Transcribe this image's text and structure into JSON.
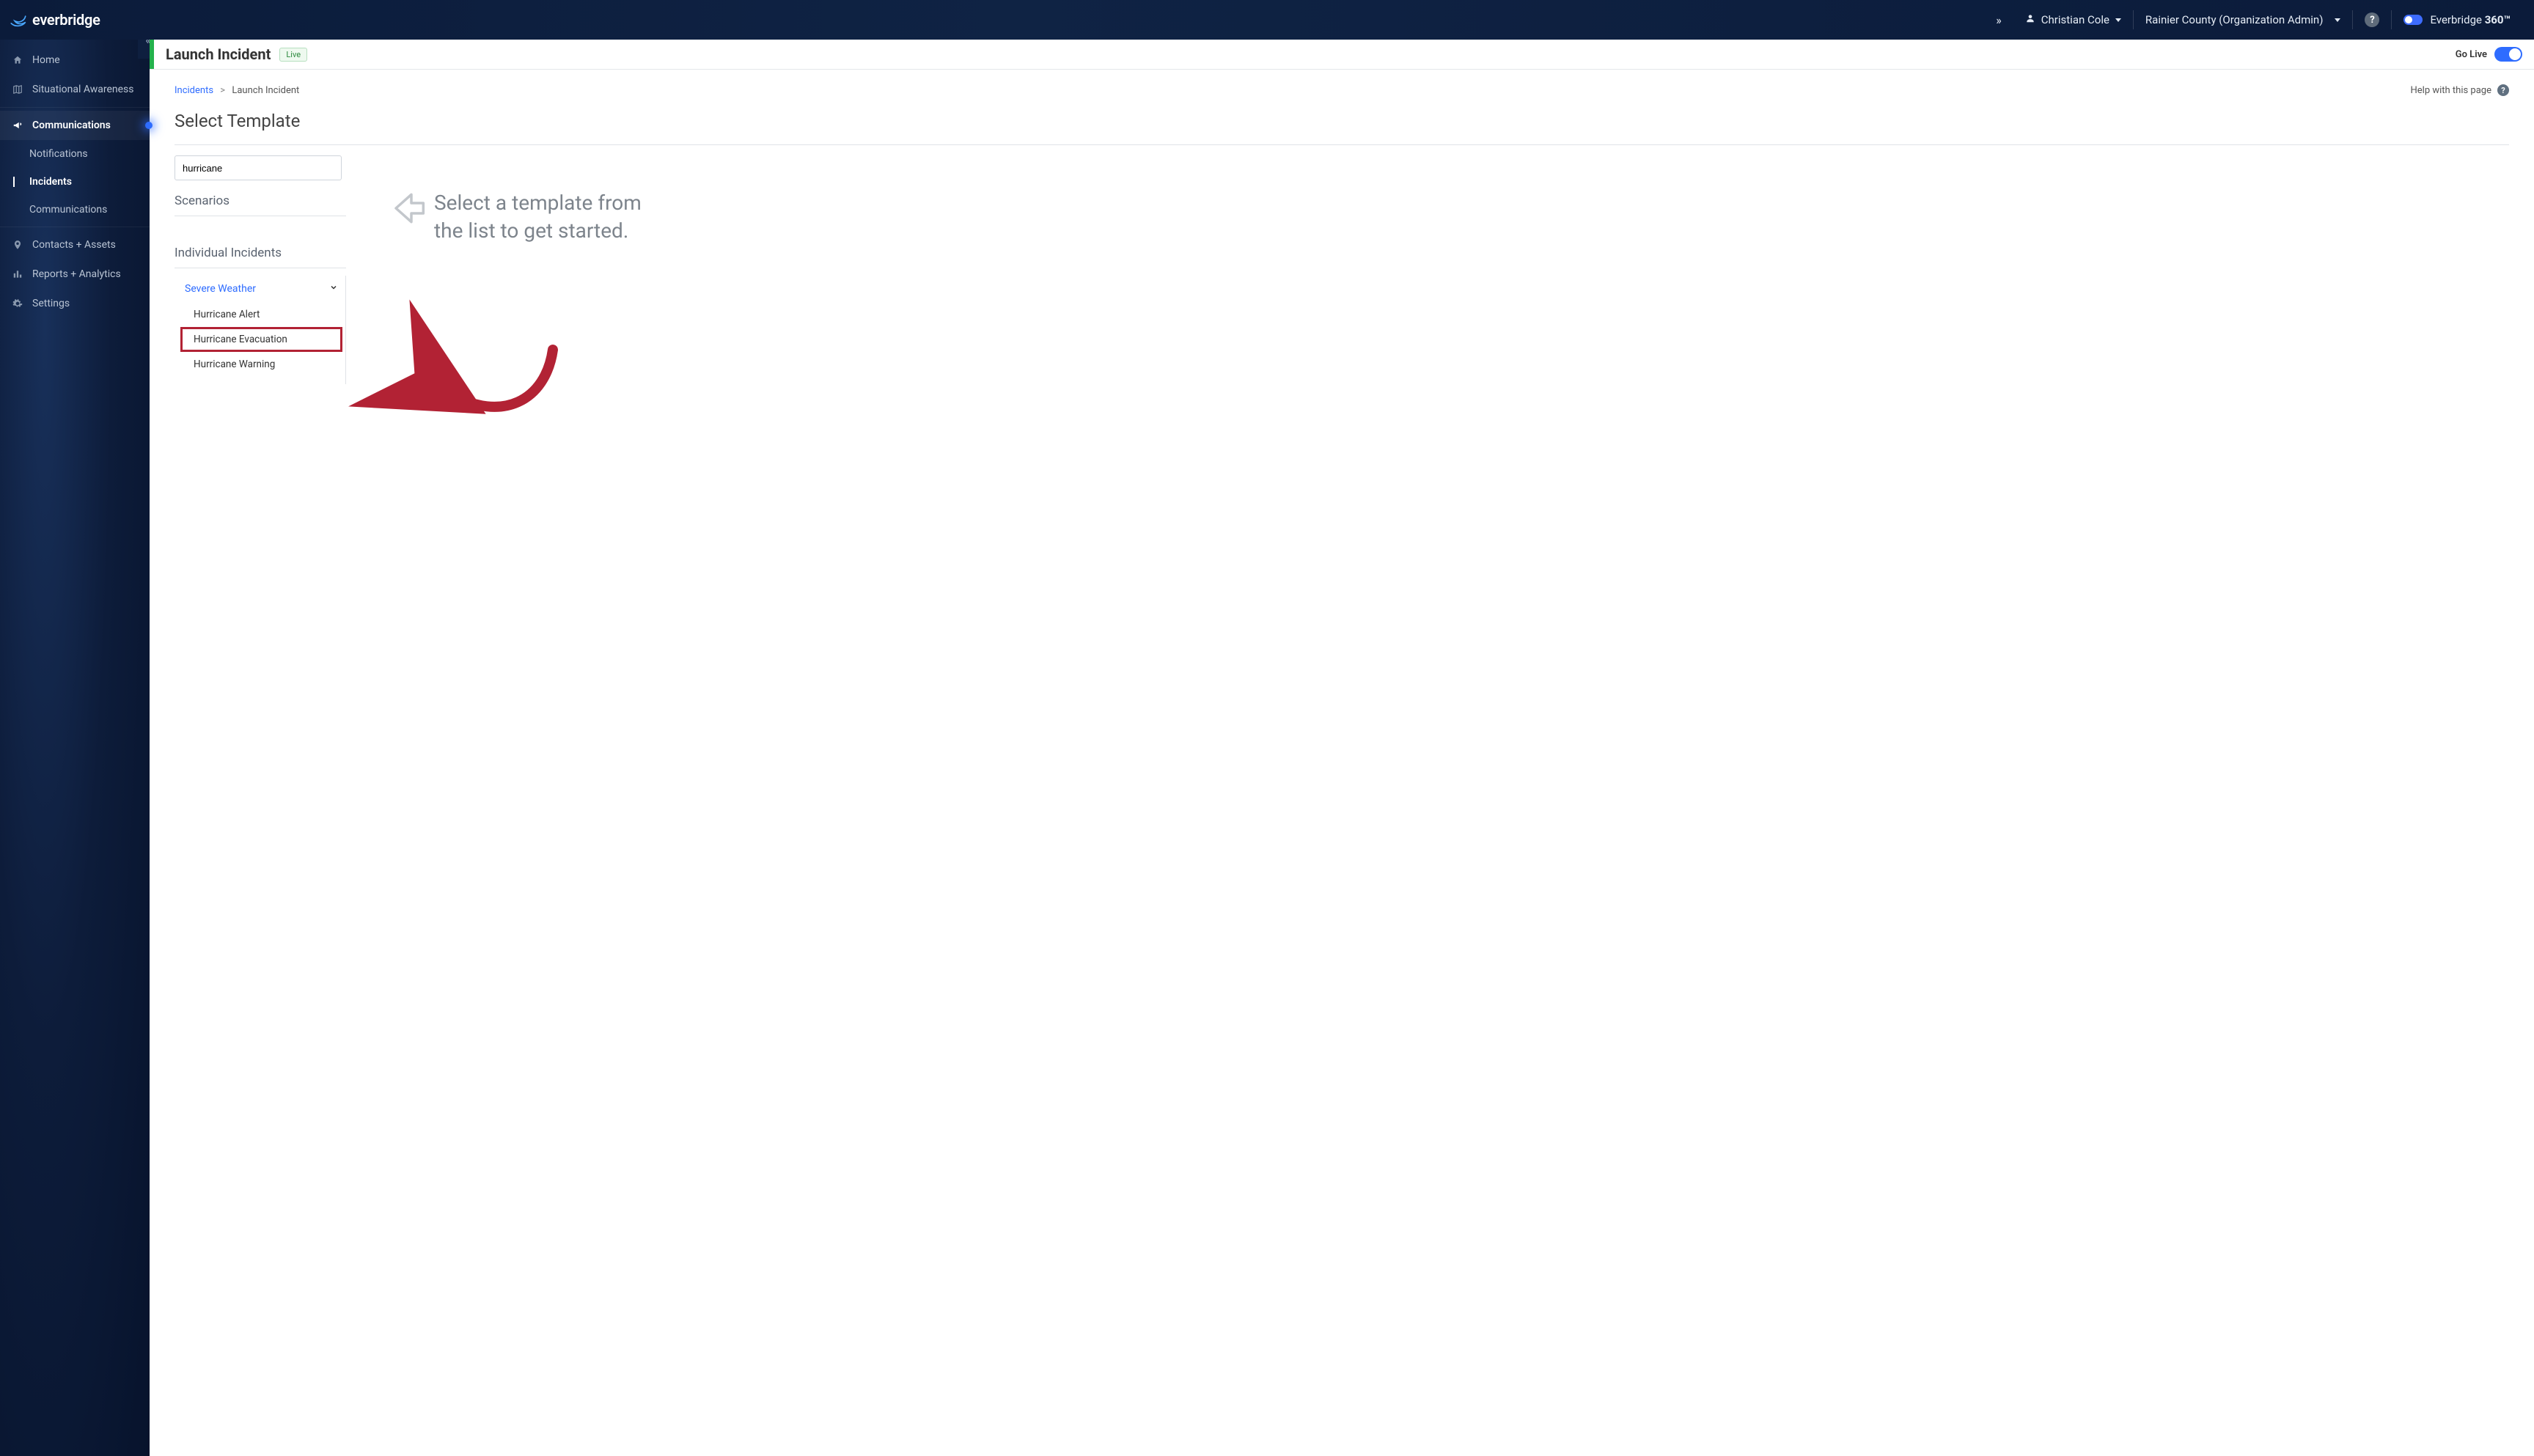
{
  "header": {
    "brand": "everbridge",
    "user_name": "Christian Cole",
    "org_context": "Rainier County (Organization Admin)",
    "product_name_prefix": "Everbridge ",
    "product_name_suffix": "360™"
  },
  "sidebar": {
    "items": [
      {
        "label": "Home",
        "icon": "home-icon"
      },
      {
        "label": "Situational Awareness",
        "icon": "map-icon"
      },
      {
        "label": "Communications",
        "icon": "megaphone-icon",
        "active_parent": true
      },
      {
        "label": "Contacts + Assets",
        "icon": "pin-icon"
      },
      {
        "label": "Reports + Analytics",
        "icon": "chart-icon"
      },
      {
        "label": "Settings",
        "icon": "gear-icon"
      }
    ],
    "sub_items": [
      {
        "label": "Notifications"
      },
      {
        "label": "Incidents",
        "active": true
      },
      {
        "label": "Communications"
      }
    ]
  },
  "pageheader": {
    "title": "Launch Incident",
    "live_badge": "Live",
    "golive_label": "Go Live"
  },
  "breadcrumb": {
    "root": "Incidents",
    "current": "Launch Incident",
    "help_label": "Help with this page"
  },
  "page": {
    "title": "Select Template",
    "search_value": "hurricane",
    "scenarios_heading": "Scenarios",
    "individual_heading": "Individual Incidents",
    "category": "Severe Weather",
    "templates": [
      "Hurricane Alert",
      "Hurricane Evacuation",
      "Hurricane Warning"
    ],
    "placeholder_line1": "Select a template from",
    "placeholder_line2": "the list to get started."
  },
  "annotation": {
    "highlight_index": 1,
    "arrow_color": "#b22234"
  }
}
